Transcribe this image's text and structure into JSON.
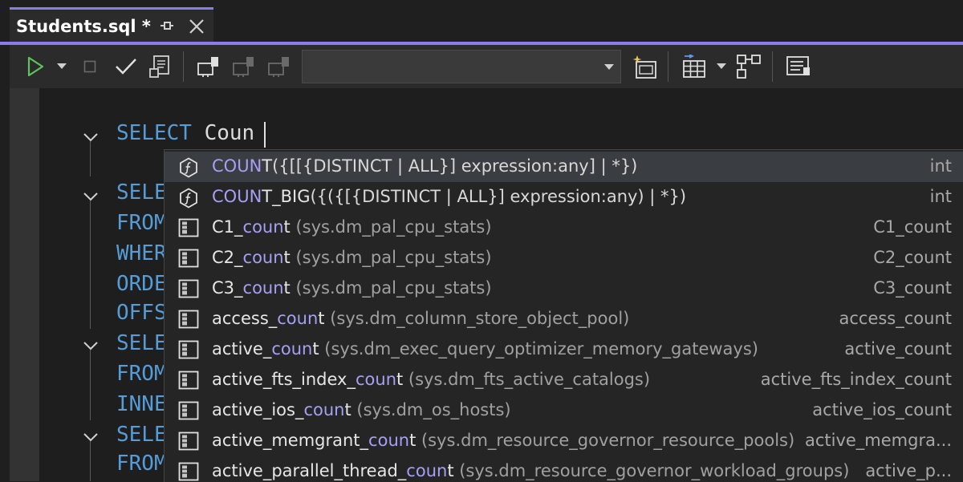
{
  "tab": {
    "title": "Students.sql *"
  },
  "toolbar": {
    "database_value": ""
  },
  "editor": {
    "lines": [
      {
        "keyword": "SELECT",
        "rest": "Coun"
      },
      {
        "keyword": "SELE"
      },
      {
        "keyword": "FROM"
      },
      {
        "keyword": "WHER"
      },
      {
        "keyword": "ORDE"
      },
      {
        "keyword": "OFFS"
      },
      {
        "keyword": "SELE"
      },
      {
        "keyword": "FROM"
      },
      {
        "keyword": "INNE"
      },
      {
        "keyword": "SELE"
      },
      {
        "keyword": "FROM"
      }
    ]
  },
  "completion": {
    "items": [
      {
        "icon": "function-icon",
        "match": "COUN",
        "rest": "T",
        "sig": "({[[{DISTINCT | ALL}] expression:any] | *})",
        "source": "",
        "type": "int"
      },
      {
        "icon": "function-icon",
        "match": "COUN",
        "rest": "T_BIG",
        "sig": "({({[{DISTINCT | ALL}] expression:any) | *})",
        "source": "",
        "type": "int"
      },
      {
        "icon": "column-icon",
        "pre": "C1_",
        "match": "coun",
        "rest": "t",
        "source": " (sys.dm_pal_cpu_stats)",
        "type": "C1_count"
      },
      {
        "icon": "column-icon",
        "pre": "C2_",
        "match": "coun",
        "rest": "t",
        "source": " (sys.dm_pal_cpu_stats)",
        "type": "C2_count"
      },
      {
        "icon": "column-icon",
        "pre": "C3_",
        "match": "coun",
        "rest": "t",
        "source": " (sys.dm_pal_cpu_stats)",
        "type": "C3_count"
      },
      {
        "icon": "column-icon",
        "pre": "access_",
        "match": "coun",
        "rest": "t",
        "source": " (sys.dm_column_store_object_pool)",
        "type": "access_count"
      },
      {
        "icon": "column-icon",
        "pre": "active_",
        "match": "coun",
        "rest": "t",
        "source": " (sys.dm_exec_query_optimizer_memory_gateways)",
        "type": "active_count"
      },
      {
        "icon": "column-icon",
        "pre": "active_fts_index_",
        "match": "coun",
        "rest": "t",
        "source": " (sys.dm_fts_active_catalogs)",
        "type": "active_fts_index_count"
      },
      {
        "icon": "column-icon",
        "pre": "active_ios_",
        "match": "coun",
        "rest": "t",
        "source": " (sys.dm_os_hosts)",
        "type": "active_ios_count"
      },
      {
        "icon": "column-icon",
        "pre": "active_memgrant_",
        "match": "coun",
        "rest": "t",
        "source": " (sys.dm_resource_governor_resource_pools)",
        "type": "active_memgra..."
      },
      {
        "icon": "column-icon",
        "pre": "active_parallel_thread_",
        "match": "coun",
        "rest": "t",
        "source": " (sys.dm_resource_governor_workload_groups)",
        "type": "active_p..."
      }
    ]
  }
}
